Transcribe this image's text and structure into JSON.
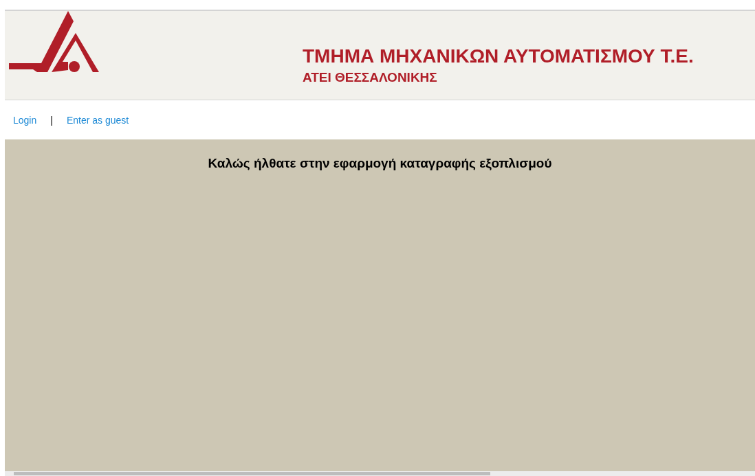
{
  "header": {
    "title": "ΤΜΗΜΑ ΜΗΧΑΝΙΚΩΝ ΑΥΤΟΜΑΤΙΣΜΟΥ Τ.Ε.",
    "subtitle": "ΑΤΕΙ ΘΕΣΣΑΛΟΝΙΚΗΣ"
  },
  "nav": {
    "links": [
      "Login",
      "Enter as guest"
    ],
    "separator": "|"
  },
  "main": {
    "heading": "Καλώς ήλθατε στην εφαρμογή καταγραφής εξοπλισμού"
  }
}
